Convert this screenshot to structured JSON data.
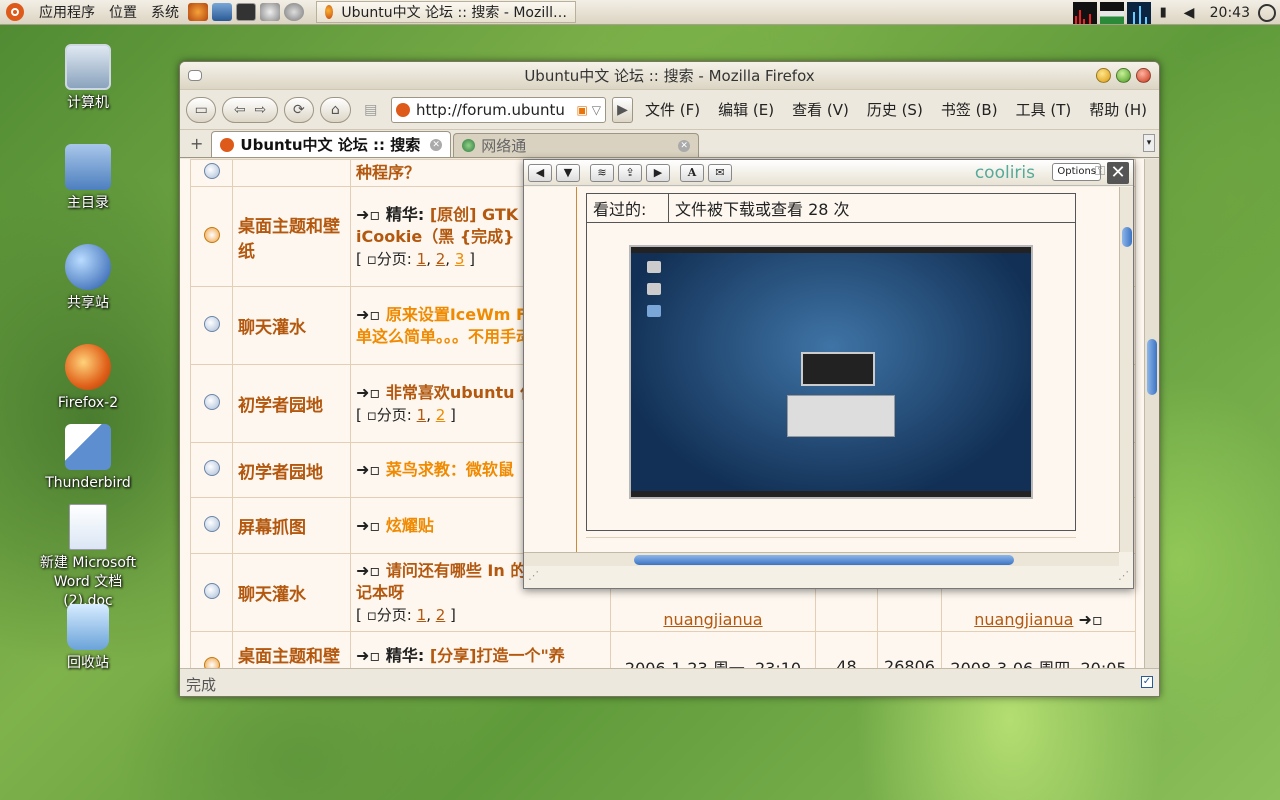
{
  "panel": {
    "menus": [
      "应用程序",
      "位置",
      "系统"
    ],
    "task_title": "Ubuntu中文 论坛 :: 搜索 - Mozill…",
    "clock": "20:43"
  },
  "desktop": [
    {
      "label": "计算机",
      "icon": "computer-icon"
    },
    {
      "label": "主目录",
      "icon": "home-folder-icon"
    },
    {
      "label": "共享站",
      "icon": "network-globe-icon"
    },
    {
      "label": "Firefox-2",
      "icon": "firefox-icon"
    },
    {
      "label": "Thunderbird",
      "icon": "thunderbird-icon"
    },
    {
      "label": "新建 Microsoft Word 文档 (2).doc",
      "icon": "document-icon"
    },
    {
      "label": "回收站",
      "icon": "trash-icon"
    }
  ],
  "window": {
    "title": "Ubuntu中文 论坛 :: 搜索 - Mozilla Firefox",
    "url": "http://forum.ubuntu",
    "menus": [
      "文件 (F)",
      "编辑 (E)",
      "查看 (V)",
      "历史 (S)",
      "书签 (B)",
      "工具 (T)",
      "帮助 (H)"
    ],
    "tabs": [
      {
        "label": "Ubuntu中文 论坛 :: 搜索"
      },
      {
        "label": "网络通"
      }
    ],
    "status": "完成"
  },
  "forum_rows": [
    {
      "forum": "",
      "topic_pre": "",
      "topic": "种程序？",
      "pages": [],
      "date": "",
      "replies": "",
      "views": "",
      "last": ""
    },
    {
      "forum": "桌面主题和壁纸",
      "topic_pre": "精华:",
      "topic": "[原创] GTK Theme iCookie（黑 {完成}",
      "pages": [
        "1",
        "2",
        "3"
      ],
      "date": "",
      "replies": "",
      "views": "",
      "last": ""
    },
    {
      "forum": "聊天灌水",
      "topic_pre": "",
      "topic": "原来设置IceWm Fluxbox菜单这么简单。。。不用手动。",
      "pages": [],
      "date": "",
      "replies": "",
      "views": "",
      "last": ""
    },
    {
      "forum": "初学者园地",
      "topic_pre": "",
      "topic": "非常喜欢ubuntu 但……",
      "pages": [
        "1",
        "2"
      ],
      "date": "",
      "replies": "",
      "views": "",
      "last": ""
    },
    {
      "forum": "初学者园地",
      "topic_pre": "",
      "topic": "菜鸟求教：微软鼠",
      "pages": [],
      "date": "",
      "replies": "",
      "views": "",
      "last": ""
    },
    {
      "forum": "屏幕抓图",
      "topic_pre": "",
      "topic": "炫耀贴",
      "pages": [],
      "date": "",
      "replies": "",
      "views": "",
      "last": ""
    },
    {
      "forum": "聊天灌水",
      "topic_pre": "",
      "topic": "请问还有哪些 In 的三千元笔记本呀",
      "pages": [
        "1",
        "2"
      ],
      "date": "",
      "replies": "",
      "views": "",
      "last": "",
      "user": "nuangjianua",
      "last_user": "nuangjianua"
    },
    {
      "forum": "桌面主题和壁纸",
      "topic_pre": "精华:",
      "topic": "[分享]打造一个\"养眼\"的ubuntu",
      "pages": [],
      "date": "2006-1-23 周一, 23:10",
      "replies": "48",
      "views": "26806",
      "last": "2008-3-06 周四, 20:05"
    }
  ],
  "pages_label": "分页:",
  "cooliris": {
    "brand": "cooliris",
    "options": "Options",
    "info_label": "看过的:",
    "info_value": "文件被下载或查看 28 次"
  },
  "colors": {
    "link": "#b3580e",
    "highlight": "#f08a00"
  }
}
